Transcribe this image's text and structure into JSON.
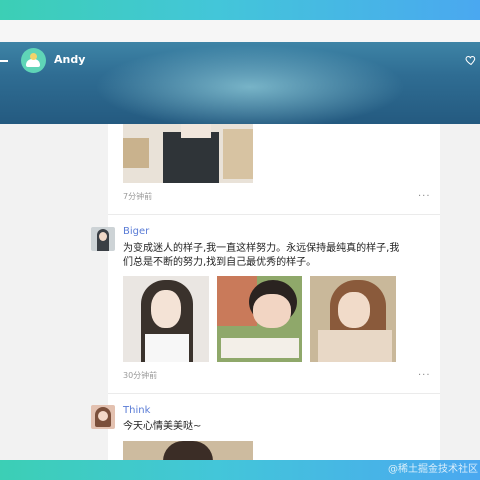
{
  "header": {
    "title": "Andy"
  },
  "posts": [
    {
      "time": "7分钟前",
      "more": "···"
    },
    {
      "username": "Biger",
      "text_line1": "为变成迷人的样子,我一直这样努力。永远保持最纯真的样子,我",
      "text_line2": "们总是不断的努力,找到自己最优秀的样子。",
      "time": "30分钟前",
      "more": "···"
    },
    {
      "username": "Think",
      "text": "今天心情美美哒~"
    }
  ],
  "watermark": "@稀土掘金技术社区"
}
